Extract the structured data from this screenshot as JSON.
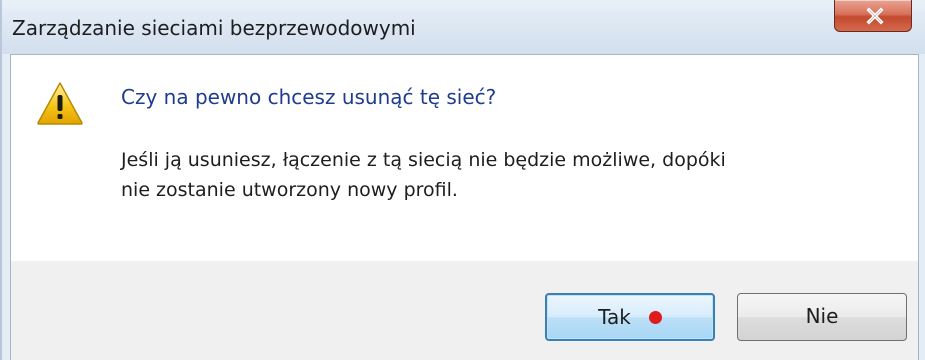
{
  "window": {
    "title": "Zarządzanie sieciami bezprzewodowymi",
    "close_icon": "close-icon"
  },
  "dialog": {
    "icon": "warning-icon",
    "heading": "Czy na pewno chcesz usunąć tę sieć?",
    "message_line1": "Jeśli ją usuniesz, łączenie z tą siecią nie będzie możliwe, dopóki",
    "message_line2": "nie zostanie utworzony nowy profil."
  },
  "buttons": {
    "yes_label": "Tak",
    "no_label": "Nie",
    "marker_color": "#e01b1b"
  },
  "colors": {
    "heading_color": "#1f3d8f",
    "close_button": "#c24a2f",
    "focus_border": "#3c7fb1"
  }
}
